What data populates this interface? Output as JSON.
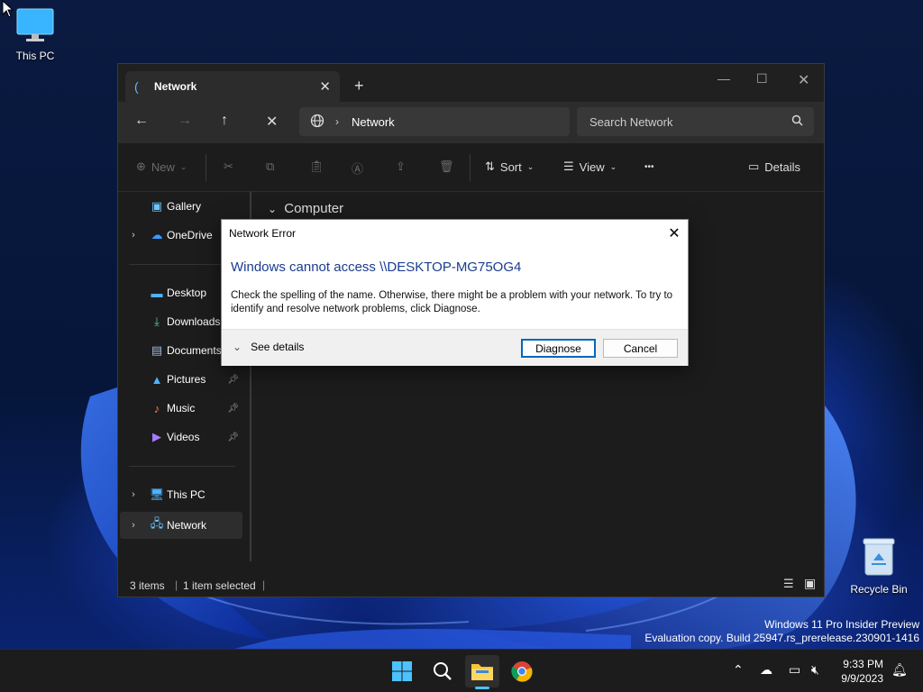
{
  "desktop": {
    "icons": [
      {
        "label": "This PC"
      },
      {
        "label": "Recycle Bin"
      }
    ],
    "watermark": {
      "line1": "Windows 11 Pro Insider Preview",
      "line2": "Evaluation copy. Build 25947.rs_prerelease.230901-1416"
    }
  },
  "explorer": {
    "tab_title": "Network",
    "tab_close": "✕",
    "new_tab": "+",
    "address": {
      "crumb": "Network"
    },
    "search_placeholder": "Search Network",
    "commands": {
      "new": "New",
      "sort": "Sort",
      "view": "View",
      "more": "•••",
      "details": "Details"
    },
    "sidebar": {
      "items": [
        {
          "label": "Gallery",
          "icon": "gallery-icon"
        },
        {
          "label": "OneDrive",
          "icon": "onedrive-icon"
        },
        {
          "label": "Desktop",
          "icon": "desktop-icon"
        },
        {
          "label": "Downloads",
          "icon": "downloads-icon"
        },
        {
          "label": "Documents",
          "icon": "documents-icon"
        },
        {
          "label": "Pictures",
          "icon": "pictures-icon"
        },
        {
          "label": "Music",
          "icon": "music-icon"
        },
        {
          "label": "Videos",
          "icon": "videos-icon"
        },
        {
          "label": "This PC",
          "icon": "this-pc-icon"
        },
        {
          "label": "Network",
          "icon": "network-icon"
        }
      ]
    },
    "content": {
      "group_header": "Computer"
    },
    "status": {
      "items": "3 items",
      "selected": "1 item selected"
    }
  },
  "dialog": {
    "title": "Network Error",
    "heading": "Windows cannot access \\\\DESKTOP-MG75OG4",
    "body": "Check the spelling of the name. Otherwise, there might be a problem with your network. To try to identify and resolve network problems, click Diagnose.",
    "see_details": "See details",
    "diagnose": "Diagnose",
    "cancel": "Cancel"
  },
  "taskbar": {
    "time": "9:33 PM",
    "date": "9/9/2023"
  },
  "colors": {
    "accent": "#4cc2ff",
    "dialog_heading": "#1a3d8f"
  }
}
